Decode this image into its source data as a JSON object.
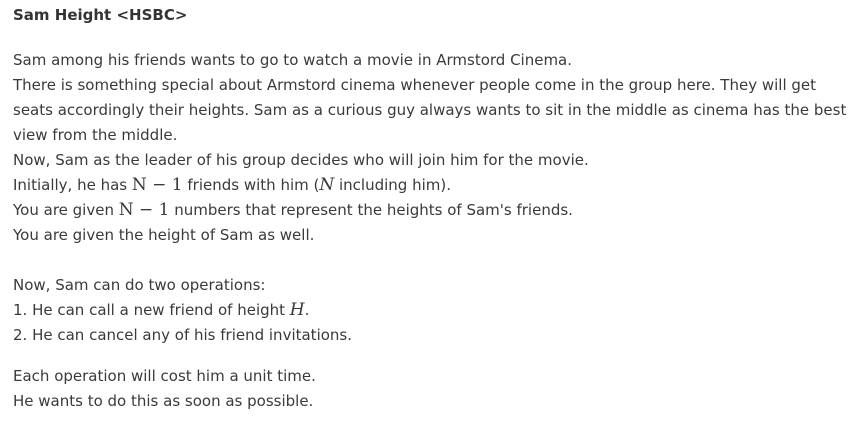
{
  "title": "Sam Height <HSBC>",
  "paragraph1": {
    "line1": "Sam among his friends wants to go to watch a movie in Armstord Cinema.",
    "line2": "There is something special about Armstord cinema whenever people come in the group here. They will get",
    "line3": "seats accordingly their heights. Sam as a curious guy always wants to sit in the middle as cinema has the best",
    "line4": "view from the middle.",
    "line5": "Now, Sam as the leader of his group decides who will join him for the movie.",
    "line6_a": "Initially, he has ",
    "line6_math": "N − 1",
    "line6_b": " friends with him (",
    "line6_math2": "N",
    "line6_c": " including him).",
    "line7_a": "You are given ",
    "line7_math": "N − 1",
    "line7_b": " numbers that represent the heights of Sam's friends.",
    "line8": "You are given the height of Sam as well."
  },
  "paragraph2": {
    "line1": "Now, Sam can do two operations:",
    "line2_a": "1. He can call a new friend of height ",
    "line2_math": "H",
    "line2_b": ".",
    "line3": "2. He can cancel any of his friend invitations."
  },
  "paragraph3": {
    "line1": "Each operation will cost him a unit time.",
    "line2": "He wants to do this as soon as possible."
  }
}
